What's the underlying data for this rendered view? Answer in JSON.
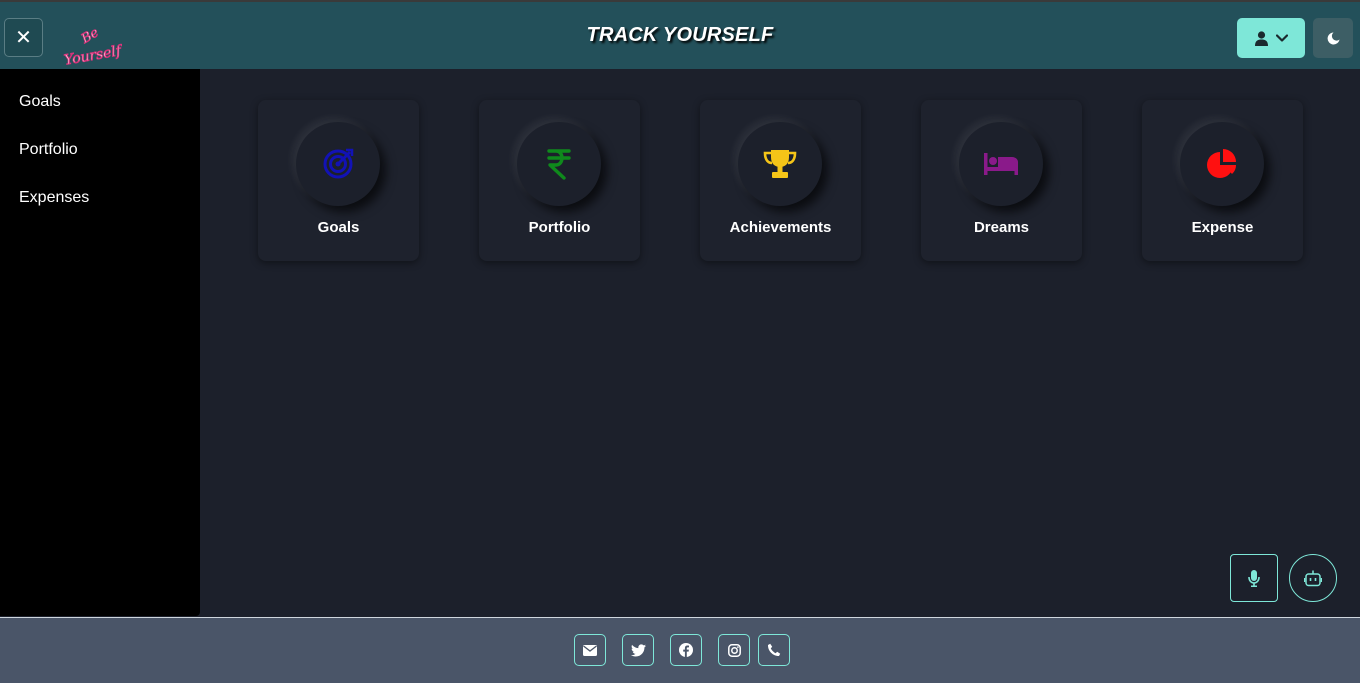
{
  "header": {
    "title": "TRACK YOURSELF",
    "close_icon": "close-icon",
    "logo_text": "Be Yourself",
    "user_menu_icon": "user-icon",
    "theme_icon": "moon-icon",
    "accent": "#7ee7d8",
    "background": "#23505a"
  },
  "sidebar": {
    "items": [
      {
        "label": "Goals"
      },
      {
        "label": "Portfolio"
      },
      {
        "label": "Expenses"
      }
    ]
  },
  "cards": [
    {
      "label": "Goals",
      "icon": "target-icon",
      "color": "#1010b0"
    },
    {
      "label": "Portfolio",
      "icon": "rupee-icon",
      "color": "#0f8a1c"
    },
    {
      "label": "Achievements",
      "icon": "trophy-icon",
      "color": "#f5c518"
    },
    {
      "label": "Dreams",
      "icon": "bed-icon",
      "color": "#8a1a8a"
    },
    {
      "label": "Expense",
      "icon": "pie-chart-icon",
      "color": "#ff1010"
    }
  ],
  "floating": {
    "mic_icon": "microphone-icon",
    "bot_icon": "robot-icon"
  },
  "footer": {
    "icons": [
      "envelope-icon",
      "twitter-icon",
      "facebook-icon",
      "instagram-icon",
      "phone-icon"
    ]
  }
}
